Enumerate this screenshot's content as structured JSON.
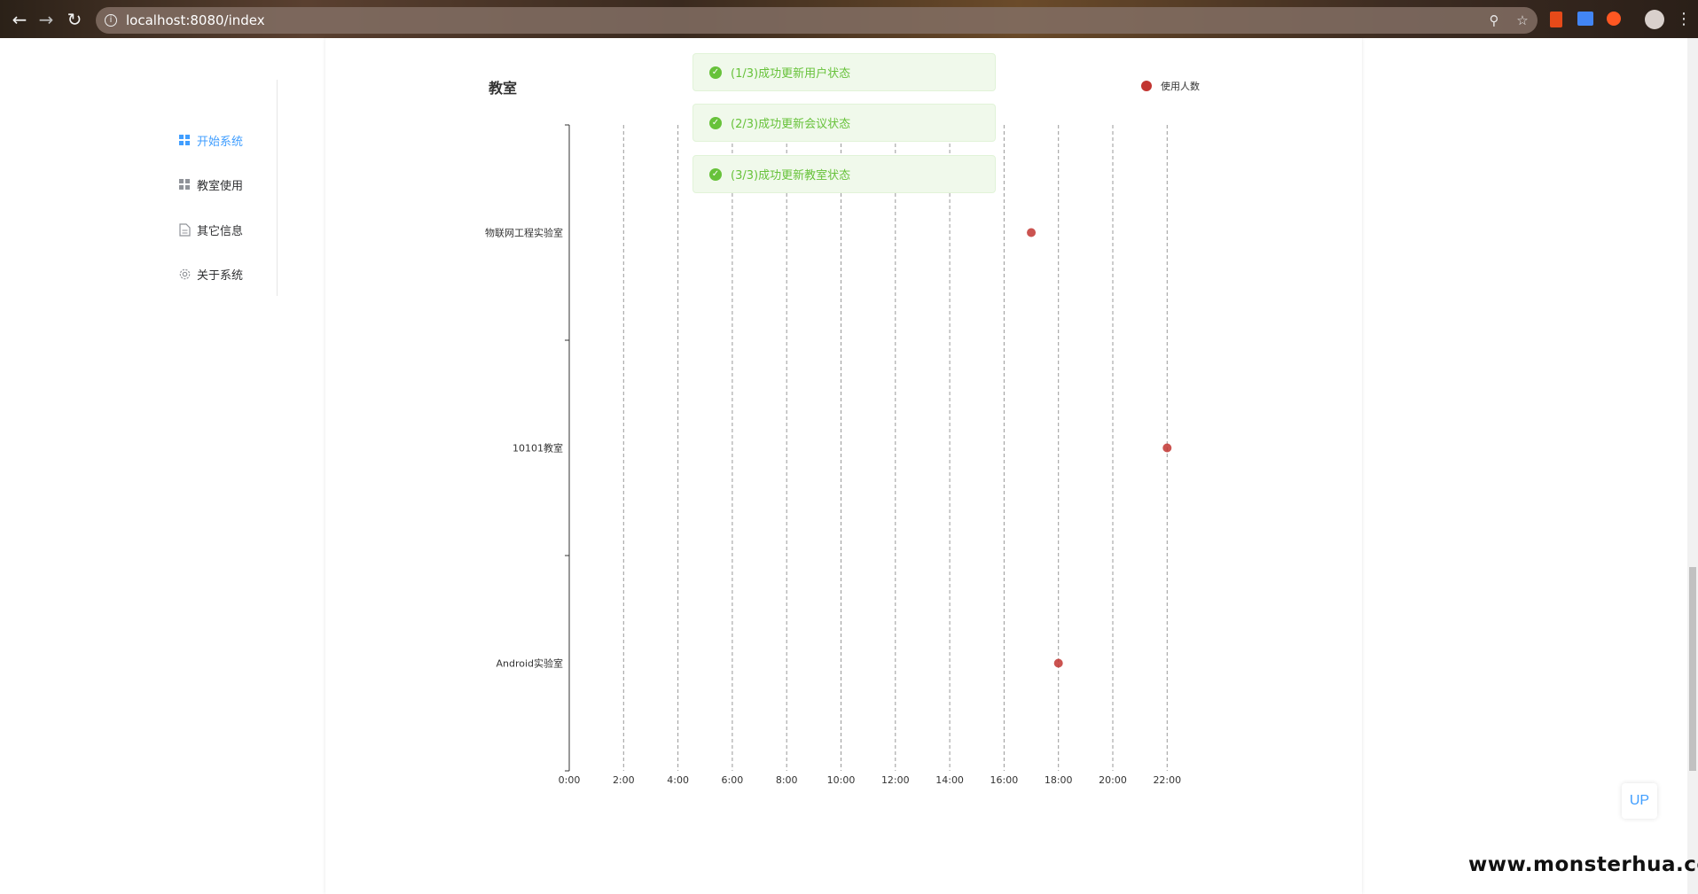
{
  "browser": {
    "url": "localhost:8080/index",
    "back_glyph": "←",
    "forward_glyph": "→",
    "reload_glyph": "↻",
    "info_glyph": "i",
    "zoom_glyph": "⚲",
    "star_glyph": "☆",
    "menu_glyph": "⋮"
  },
  "sidebar": {
    "items": [
      {
        "label": "开始系统",
        "icon": "grid-icon",
        "active": true
      },
      {
        "label": "教室使用",
        "icon": "grid-icon",
        "active": false
      },
      {
        "label": "其它信息",
        "icon": "document-icon",
        "active": false
      },
      {
        "label": "关于系统",
        "icon": "gear-icon",
        "active": false
      }
    ]
  },
  "messages": [
    {
      "text": "(1/3)成功更新用户状态"
    },
    {
      "text": "(2/3)成功更新会议状态"
    },
    {
      "text": "(3/3)成功更新教室状态"
    }
  ],
  "colors": {
    "accent": "#409eff",
    "success": "#67c23a",
    "series": "#c23531"
  },
  "chart_data": {
    "type": "scatter",
    "title": "教室",
    "legend": {
      "entries": [
        "使用人数"
      ],
      "position": "top-right"
    },
    "x_ticks": [
      "0:00",
      "2:00",
      "4:00",
      "6:00",
      "8:00",
      "10:00",
      "12:00",
      "14:00",
      "16:00",
      "18:00",
      "20:00",
      "22:00"
    ],
    "categories": [
      "物联网工程实验室",
      "10101教室",
      "Android实验室"
    ],
    "xlim": [
      0,
      22
    ],
    "grid": true,
    "series": [
      {
        "name": "使用人数",
        "points": [
          {
            "category": "物联网工程实验室",
            "x": 17
          },
          {
            "category": "10101教室",
            "x": 22
          },
          {
            "category": "Android实验室",
            "x": 18
          }
        ]
      }
    ]
  },
  "up_button": {
    "label": "UP"
  },
  "watermark": {
    "text": "www.monsterhua.com"
  }
}
